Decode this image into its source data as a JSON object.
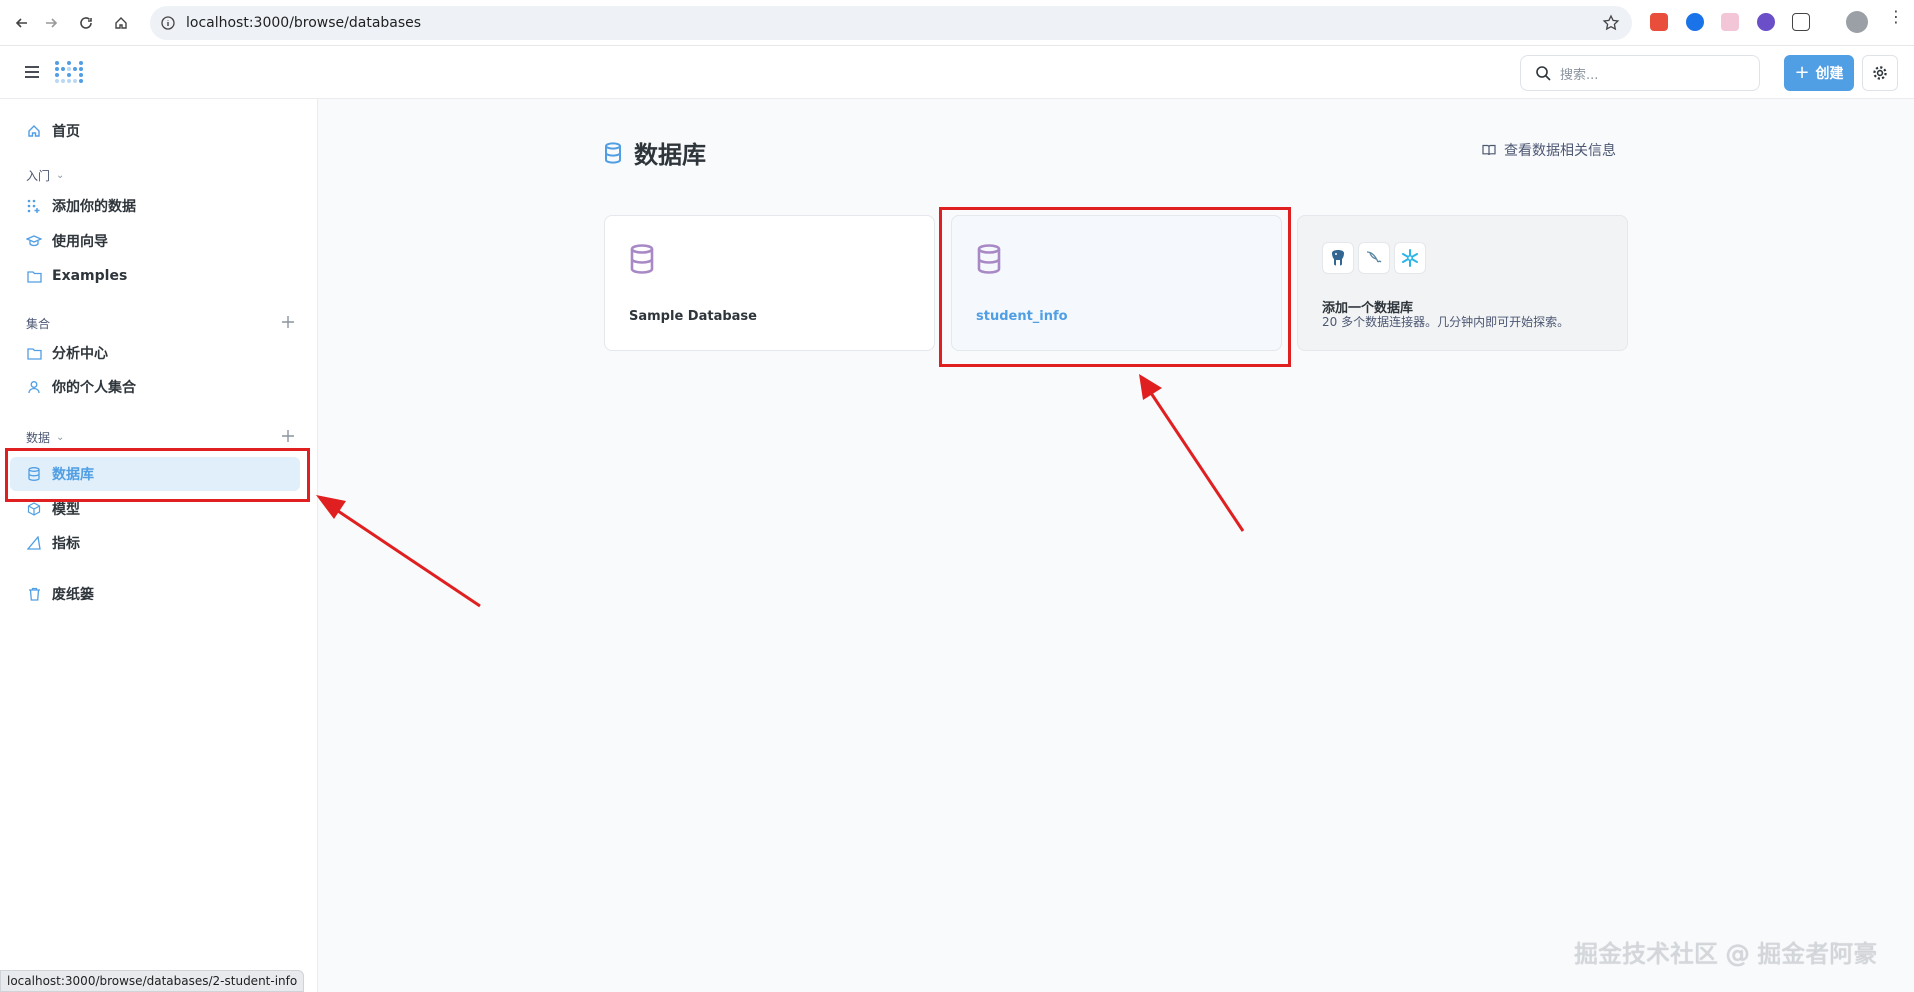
{
  "browser": {
    "url": "localhost:3000/browse/databases"
  },
  "header": {
    "search_placeholder": "搜索...",
    "create_label": "创建"
  },
  "sidebar": {
    "home": "首页",
    "getting_started": {
      "label": "入门",
      "items": [
        "添加你的数据",
        "使用向导",
        "Examples"
      ]
    },
    "collections": {
      "label": "集合",
      "items": [
        "分析中心",
        "你的个人集合"
      ]
    },
    "data": {
      "label": "数据",
      "items": [
        "数据库",
        "模型",
        "指标"
      ]
    },
    "trash": "废纸篓"
  },
  "main": {
    "title": "数据库",
    "learn_link": "查看数据相关信息",
    "databases": [
      {
        "name": "Sample Database"
      },
      {
        "name": "student_info"
      }
    ],
    "add_card": {
      "title": "添加一个数据库",
      "description": "20 多个数据连接器。几分钟内即可开始探索。"
    }
  },
  "status_bar": {
    "link_preview": "localhost:3000/browse/databases/2-student-info"
  },
  "watermark": "掘金技术社区 @ 掘金者阿豪",
  "colors": {
    "brand": "#509ee3",
    "highlight": "#e02020",
    "db_icon": "#a989c5"
  }
}
